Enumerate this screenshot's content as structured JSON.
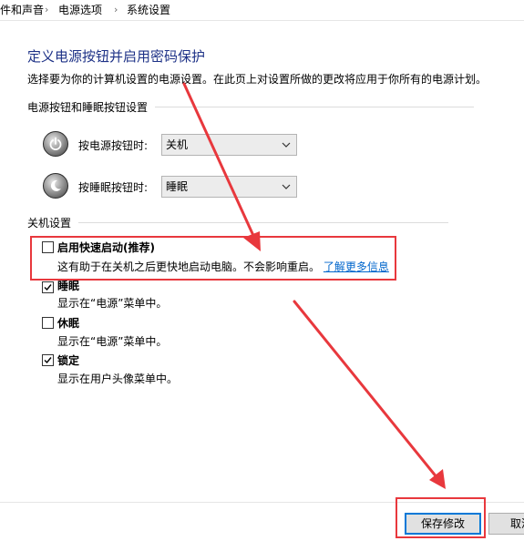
{
  "breadcrumb": {
    "items": [
      "件和声音",
      "电源选项",
      "系统设置"
    ],
    "separator": "›"
  },
  "header": {
    "title": "定义电源按钮并启用密码保护",
    "description": "选择要为你的计算机设置的电源设置。在此页上对设置所做的更改将应用于你所有的电源计划。"
  },
  "power_buttons": {
    "section_title": "电源按钮和睡眠按钮设置",
    "power_label": "按电源按钮时:",
    "power_value": "关机",
    "sleep_label": "按睡眠按钮时:",
    "sleep_value": "睡眠"
  },
  "shutdown": {
    "section_title": "关机设置",
    "options": [
      {
        "title": "启用快速启动(推荐)",
        "desc": "这有助于在关机之后更快地启动电脑。不会影响重启。",
        "link": "了解更多信息",
        "checked": false
      },
      {
        "title": "睡眠",
        "desc": "显示在“电源”菜单中。",
        "checked": true
      },
      {
        "title": "休眠",
        "desc": "显示在“电源”菜单中。",
        "checked": false
      },
      {
        "title": "锁定",
        "desc": "显示在用户头像菜单中。",
        "checked": true
      }
    ]
  },
  "footer": {
    "save_label": "保存修改",
    "cancel_label": "取消"
  },
  "colors": {
    "title": "#1e3287",
    "link": "#0066cc",
    "annotation": "#e8383d"
  }
}
